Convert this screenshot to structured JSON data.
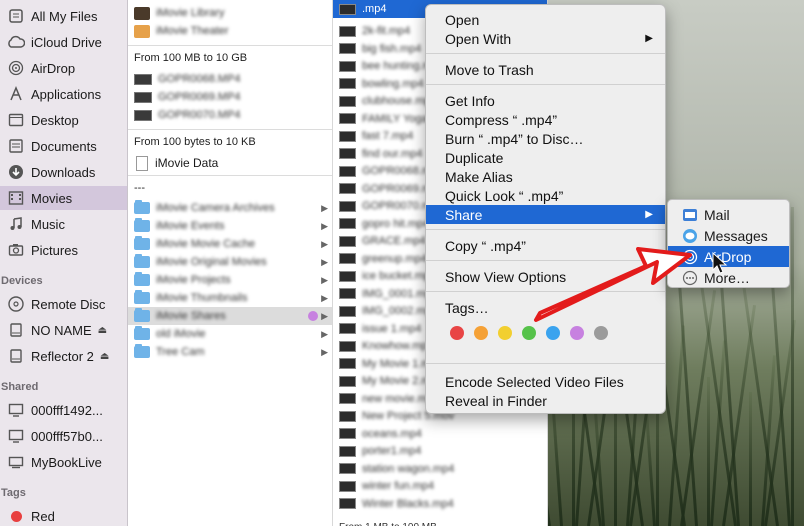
{
  "sidebar": {
    "favorites": [
      {
        "label": "All My Files",
        "icon": "all-files-icon"
      },
      {
        "label": "iCloud Drive",
        "icon": "cloud-icon"
      },
      {
        "label": "AirDrop",
        "icon": "airdrop-icon"
      },
      {
        "label": "Applications",
        "icon": "applications-icon"
      },
      {
        "label": "Desktop",
        "icon": "desktop-icon"
      },
      {
        "label": "Documents",
        "icon": "documents-icon"
      },
      {
        "label": "Downloads",
        "icon": "downloads-icon"
      },
      {
        "label": "Movies",
        "icon": "movies-icon",
        "selected": true
      },
      {
        "label": "Music",
        "icon": "music-icon"
      },
      {
        "label": "Pictures",
        "icon": "pictures-icon"
      }
    ],
    "devices_header": "Devices",
    "devices": [
      {
        "label": "Remote Disc",
        "icon": "disc-icon"
      },
      {
        "label": "NO NAME",
        "icon": "drive-icon",
        "eject": "⏏"
      },
      {
        "label": "Reflector 2",
        "icon": "drive-icon",
        "eject": "⏏"
      }
    ],
    "shared_header": "Shared",
    "shared": [
      {
        "label": "000fff1492...",
        "icon": "computer-icon"
      },
      {
        "label": "000fff57b0...",
        "icon": "computer-icon"
      },
      {
        "label": "MyBookLive",
        "icon": "nas-icon"
      }
    ],
    "tags_header": "Tags",
    "tags": [
      {
        "label": "Red",
        "color": "#e84040"
      }
    ]
  },
  "column1": {
    "top_items": [
      "iMovie Library",
      "iMovie Theater"
    ],
    "section1_header": "From 100 MB to 10 GB",
    "section1_items": [
      "GOPR0068.MP4",
      "GOPR0069.MP4",
      "GOPR0070.MP4"
    ],
    "section2_header": "From 100 bytes to 10 KB",
    "section2_items": [
      "iMovie Data"
    ],
    "section3_header": "---",
    "folders": [
      "iMovie Camera Archives",
      "iMovie Events",
      "iMovie Movie Cache",
      "iMovie Original Movies",
      "iMovie Projects",
      "iMovie Thumbnails",
      "iMovie Shares",
      "old iMovie",
      "Tree Cam"
    ]
  },
  "column2": {
    "selected_file": ".mp4",
    "files": [
      "2k-fit.mp4",
      "big fish.mp4",
      "bee hunting.mp4",
      "bowling.mp4",
      "clubhouse.mp4",
      "FAMILY Yoga.mp4",
      "fast 7.mp4",
      "find our.mp4",
      "GOPR0068.mp4",
      "GOPR0069.mp4",
      "GOPR0070.mp4",
      "gopro hit.mp4",
      "GRACE.mp4",
      "greenup.mp4",
      "ice bucket.mp4",
      "IMG_0001.mp4",
      "IMG_0002.mp4",
      "issue 1.mp4",
      "Knowhow.mp4",
      "My Movie 1.mp4",
      "My Movie 2.mp4",
      "new movie.mp4",
      "New Project 5.mov",
      "oceans.mp4",
      "porter1.mp4",
      "station wagon.mp4",
      "winter fun.mp4",
      "Winter Blacks.mp4"
    ],
    "footer": "From 1 MB to 100 MB"
  },
  "context_menu": {
    "open": "Open",
    "open_with": "Open With",
    "move_to_trash": "Move to Trash",
    "get_info": "Get Info",
    "compress": "Compress “ .mp4”",
    "burn": "Burn “ .mp4” to Disc…",
    "duplicate": "Duplicate",
    "make_alias": "Make Alias",
    "quick_look": "Quick Look “ .mp4”",
    "share": "Share",
    "copy": "Copy “ .mp4”",
    "show_view_options": "Show View Options",
    "tags": "Tags…",
    "tag_colors": [
      "#e84545",
      "#f5a136",
      "#f2cf2f",
      "#56c24a",
      "#3aa3ee",
      "#c781e0",
      "#9b9b9b"
    ],
    "encode": "Encode Selected Video Files",
    "reveal": "Reveal in Finder",
    "submenu_arrow": "▶"
  },
  "share_submenu": {
    "mail": "Mail",
    "messages": "Messages",
    "airdrop": "AirDrop",
    "more": "More…"
  },
  "colors": {
    "selection": "#1f68d3",
    "sidebar_bg": "#ebe6ec",
    "annotation_arrow": "#e31b1b"
  }
}
